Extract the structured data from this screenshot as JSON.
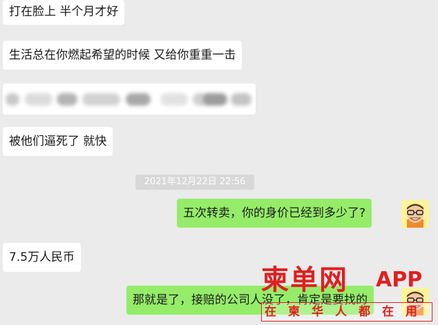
{
  "chat": {
    "messages": [
      {
        "side": "left",
        "text": "打在脸上 半个月才好"
      },
      {
        "side": "left",
        "text": "生活总在你燃起希望的时候 又给你重重一击"
      },
      {
        "side": "left",
        "text": "",
        "blurred": true
      },
      {
        "side": "left",
        "text": "被他们逼死了 就快"
      },
      {
        "side": "right",
        "text": "五次转卖，你的身价已经到多少了?"
      },
      {
        "side": "left",
        "text": "7.5万人民币"
      },
      {
        "side": "right",
        "text": "那就是了，接赔的公司人没了，肯定是要找的"
      }
    ],
    "timestamp": "2021年12月22日 22:56"
  },
  "watermark": {
    "main": "柬单网",
    "app": "APP",
    "sub": "在柬华人都在用"
  },
  "colors": {
    "background": "#ebebeb",
    "left_bubble": "#ffffff",
    "right_bubble": "#95ec69",
    "timestamp_bg": "#d8d8d8",
    "watermark": "#e02020"
  },
  "icons": {
    "avatar": "cartoon-face-avatar-icon"
  }
}
